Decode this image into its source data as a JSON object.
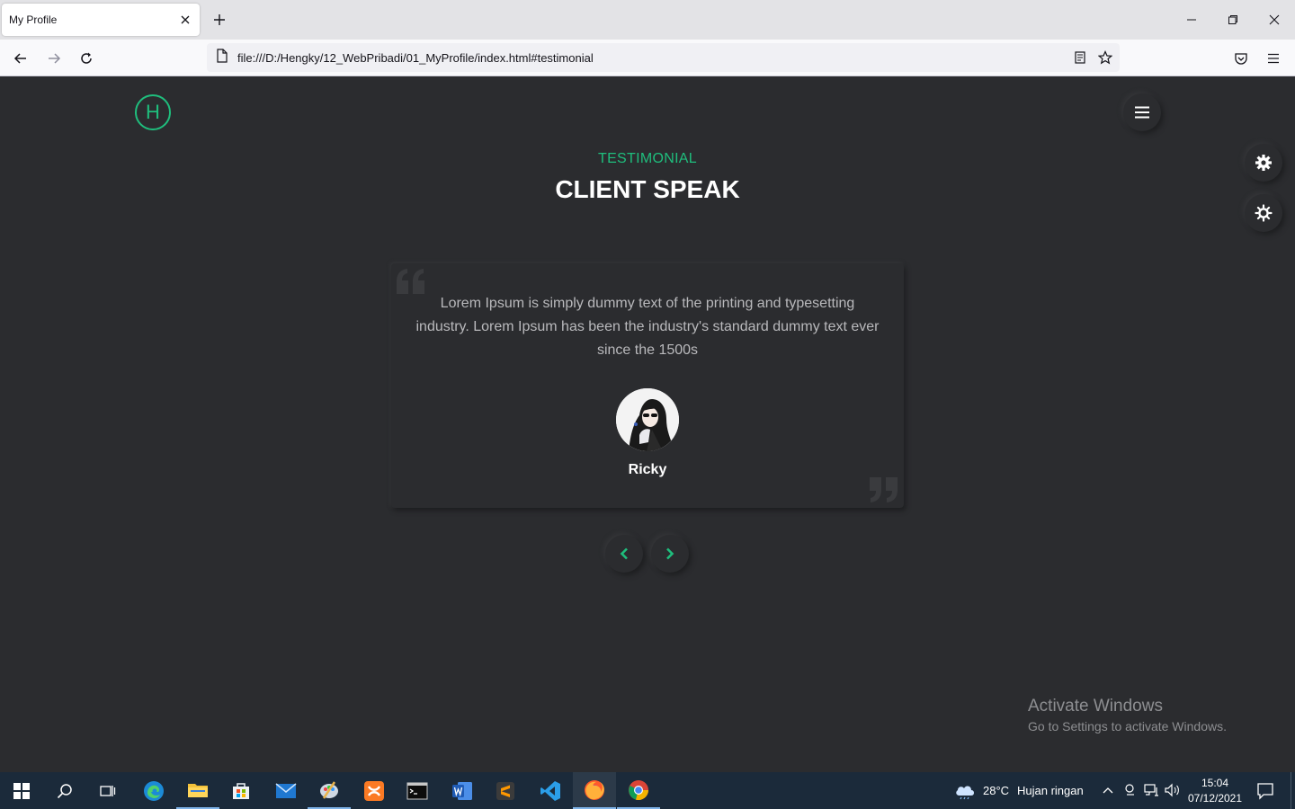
{
  "browser": {
    "tab_title": "My Profile",
    "url": "file:///D:/Hengky/12_WebPribadi/01_MyProfile/index.html#testimonial"
  },
  "page": {
    "logo_letter": "H",
    "section_subtitle": "TESTIMONIAL",
    "section_title": "CLIENT SPEAK",
    "testimonial": {
      "text": "Lorem Ipsum is simply dummy text of the printing and typesetting industry. Lorem Ipsum has been the industry's standard dummy text ever since the 1500s",
      "client_name": "Ricky"
    },
    "accent_color": "#1fbe7d",
    "background_color": "#2b2c2f"
  },
  "watermark": {
    "title": "Activate Windows",
    "subtitle": "Go to Settings to activate Windows."
  },
  "taskbar": {
    "weather": "28°C",
    "weather_desc": "Hujan ringan",
    "time": "15:04",
    "date": "07/12/2021"
  }
}
